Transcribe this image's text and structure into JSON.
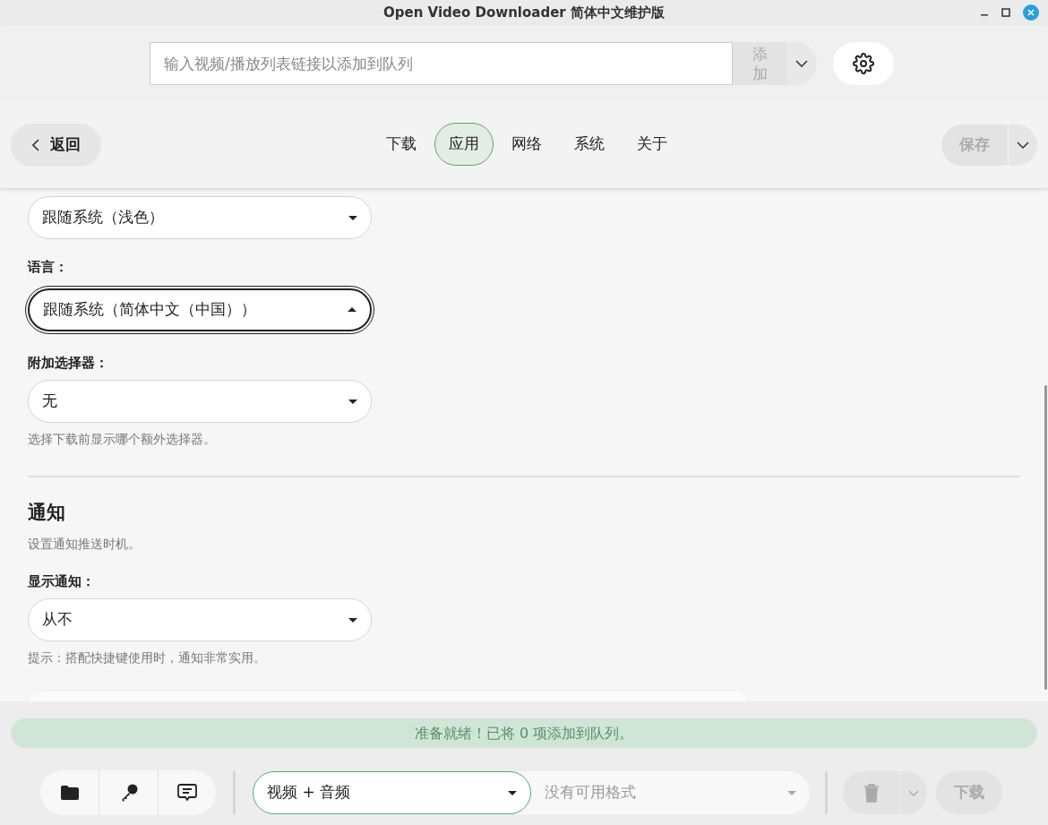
{
  "window": {
    "title": "Open Video Downloader 简体中文维护版"
  },
  "url_bar": {
    "placeholder": "输入视频/播放列表链接以添加到队列",
    "add_button": "添加",
    "add_disabled": true
  },
  "nav": {
    "back": "返回",
    "tabs": [
      {
        "label": "下载",
        "selected": false
      },
      {
        "label": "应用",
        "selected": true
      },
      {
        "label": "网络",
        "selected": false
      },
      {
        "label": "系统",
        "selected": false
      },
      {
        "label": "关于",
        "selected": false
      }
    ],
    "save": "保存",
    "save_disabled": true
  },
  "settings": [
    {
      "kind": "select",
      "value": "跟随系统（浅色）",
      "open": false
    },
    {
      "kind": "label",
      "text": "语言："
    },
    {
      "kind": "select",
      "value": "跟随系统（简体中文（中国））",
      "open": true
    },
    {
      "kind": "label",
      "text": "附加选择器："
    },
    {
      "kind": "select",
      "value": "无",
      "open": false
    },
    {
      "kind": "hint",
      "text": "选择下载前显示哪个额外选择器。"
    },
    {
      "kind": "divider"
    },
    {
      "kind": "heading",
      "text": "通知"
    },
    {
      "kind": "hint",
      "text": "设置通知推送时机。"
    },
    {
      "kind": "label",
      "text": "显示通知："
    },
    {
      "kind": "select",
      "value": "从不",
      "open": false
    },
    {
      "kind": "hint",
      "text": "提示：搭配快捷键使用时，通知非常实用。"
    },
    {
      "kind": "card"
    }
  ],
  "status": {
    "text": "准备就绪！已将 0 项添加到队列。"
  },
  "toolbar": {
    "type_select": "视频 + 音频",
    "format_placeholder": "没有可用格式",
    "delete_disabled": true,
    "download": "下载",
    "download_disabled": true
  }
}
